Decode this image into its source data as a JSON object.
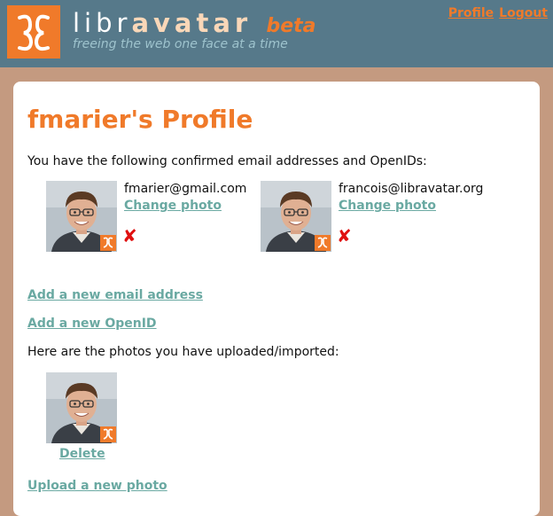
{
  "header": {
    "brand_light": "libr",
    "brand_strong": "avatar",
    "brand_beta": "beta",
    "tagline": "freeing the web one face at a time",
    "links": {
      "profile": "Profile",
      "logout": "Logout"
    }
  },
  "page": {
    "title": "fmarier's Profile",
    "intro": "You have the following confirmed email addresses and OpenIDs:",
    "entries": [
      {
        "email": "fmarier@gmail.com",
        "change_label": "Change photo",
        "delete_glyph": "✘"
      },
      {
        "email": "francois@libravatar.org",
        "change_label": "Change photo",
        "delete_glyph": "✘"
      }
    ],
    "add_email": "Add a new email address",
    "add_openid": "Add a new OpenID",
    "photos_label": "Here are the photos you have uploaded/imported:",
    "photo_delete": "Delete",
    "upload": "Upload a new photo"
  },
  "colors": {
    "header_bg": "#56798a",
    "accent": "#f07a2a",
    "link": "#6aa9a2",
    "page_bg": "#c49a80",
    "delete": "#e01010"
  },
  "icons": {
    "logo": "libravatar-logo-icon",
    "avatar_badge": "libravatar-badge-icon",
    "delete": "red-x-icon"
  }
}
